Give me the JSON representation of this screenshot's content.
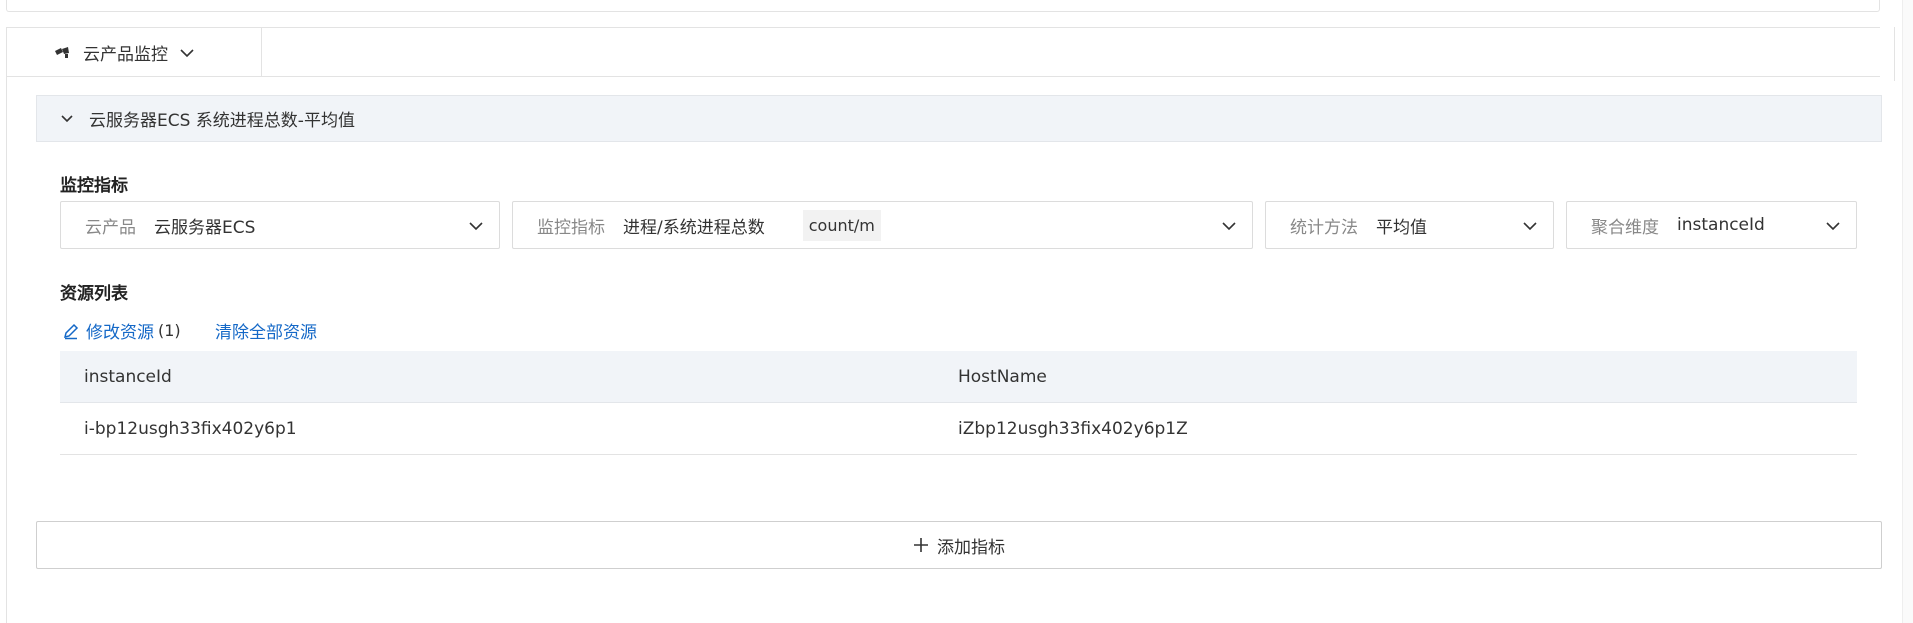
{
  "tabs": {
    "active_label": "云产品监控",
    "icon": "cloud-monitor-icon"
  },
  "section": {
    "title": "云服务器ECS 系统进程总数-平均值"
  },
  "metric_section_label": "监控指标",
  "selects": {
    "product": {
      "label": "云产品",
      "value": "云服务器ECS"
    },
    "metric": {
      "label": "监控指标",
      "value": "进程/系统进程总数",
      "unit": "count/m"
    },
    "statistic": {
      "label": "统计方法",
      "value": "平均值"
    },
    "dimension": {
      "label": "聚合维度",
      "value": "instanceId"
    }
  },
  "resources": {
    "label": "资源列表",
    "edit_label": "修改资源",
    "count": "(1)",
    "clear_label": "清除全部资源",
    "columns": [
      "instanceId",
      "HostName"
    ],
    "rows": [
      [
        "i-bp12usgh33fix402y6p1",
        "iZbp12usgh33fix402y6p1Z"
      ]
    ]
  },
  "add_metric_label": "添加指标",
  "colors": {
    "link": "#1468c7",
    "header_bg": "#f1f4f8",
    "border": "#e3e3e3"
  }
}
